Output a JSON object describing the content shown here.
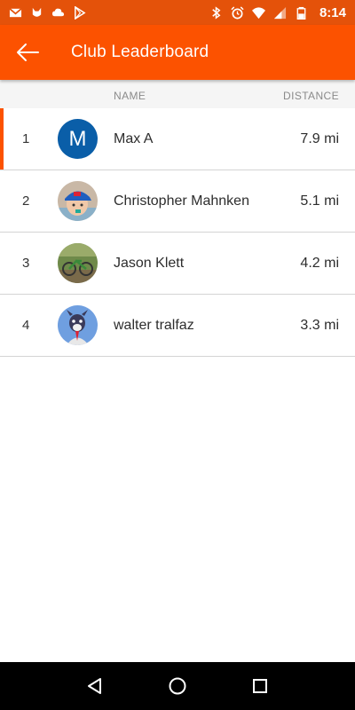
{
  "status_bar": {
    "time": "8:14",
    "left_icons": [
      "gmail-icon",
      "cat-notification-icon",
      "cloud-icon",
      "play-store-icon"
    ],
    "right_icons": [
      "bluetooth-icon",
      "alarm-icon",
      "wifi-icon",
      "signal-icon",
      "battery-icon"
    ],
    "bg_color": "#e4520a"
  },
  "app_bar": {
    "title": "Club Leaderboard",
    "bg_color": "#fc5200"
  },
  "columns": {
    "name": "NAME",
    "distance": "DISTANCE"
  },
  "leaderboard": [
    {
      "rank": "1",
      "name": "Max A",
      "distance": "7.9 mi",
      "avatar_letter": "M",
      "avatar_type": "letter",
      "avatar_color": "#0a5ea8",
      "highlight": true
    },
    {
      "rank": "2",
      "name": "Christopher Mahnken",
      "distance": "5.1 mi",
      "avatar_type": "photo-child-blue-cap"
    },
    {
      "rank": "3",
      "name": "Jason Klett",
      "distance": "4.2 mi",
      "avatar_type": "photo-bike-outdoors"
    },
    {
      "rank": "4",
      "name": "walter tralfaz",
      "distance": "3.3 mi",
      "avatar_type": "photo-cartoon-dog"
    }
  ],
  "nav_bar": {
    "buttons": [
      "back-triangle-icon",
      "home-circle-icon",
      "recents-square-icon"
    ]
  }
}
